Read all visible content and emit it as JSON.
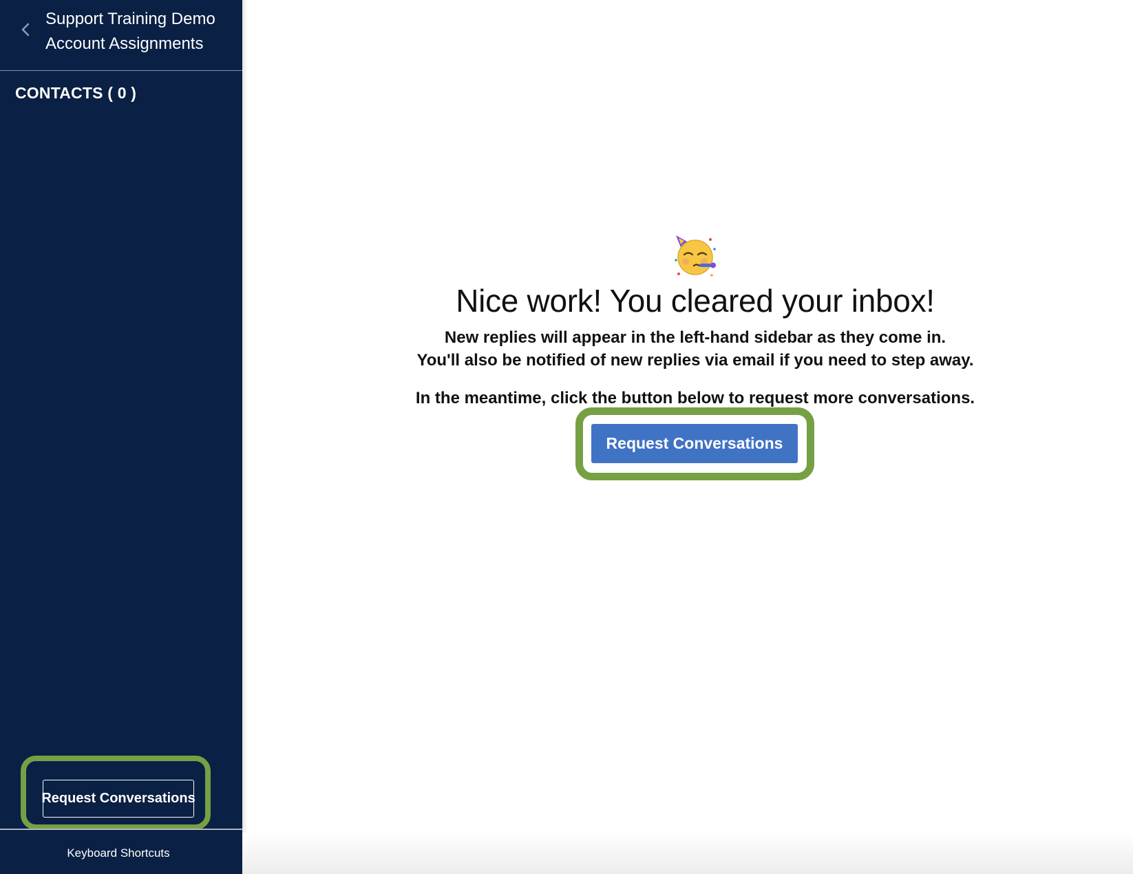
{
  "sidebar": {
    "title_line1": "Support Training Demo",
    "title_line2": "Account Assignments",
    "contacts_label": "CONTACTS ( 0 )",
    "request_button_label": "Request Conversations",
    "keyboard_shortcuts_label": "Keyboard Shortcuts",
    "back_icon": "chevron-left-icon"
  },
  "main": {
    "emoji_icon": "partying-face-icon",
    "headline": "Nice work! You cleared your inbox!",
    "line1": "New replies will appear in the left-hand sidebar as they come in.",
    "line2": "You'll also be notified of new replies via email if you need to step away.",
    "line3": "In the meantime, click the button below to request more conversations.",
    "request_button_label": "Request Conversations"
  },
  "colors": {
    "sidebar_bg": "#0a2044",
    "primary_button": "#4173c5",
    "highlight_outline": "#76a044"
  }
}
